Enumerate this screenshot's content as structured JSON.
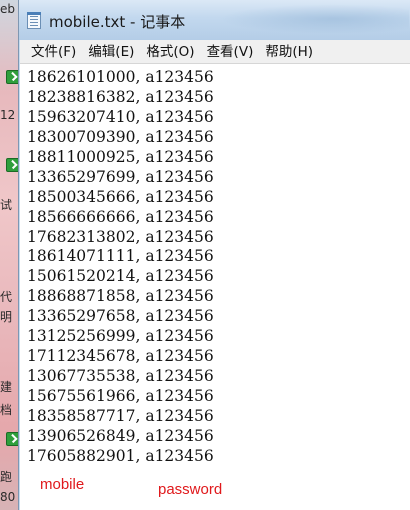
{
  "window": {
    "title": "mobile.txt - 记事本"
  },
  "menu": [
    {
      "label": "文件(F)"
    },
    {
      "label": "编辑(E)"
    },
    {
      "label": "格式(O)"
    },
    {
      "label": "查看(V)"
    },
    {
      "label": "帮助(H)"
    }
  ],
  "editor": {
    "lines": [
      "18626101000, a123456",
      "18238816382, a123456",
      "15963207410, a123456",
      "18300709390, a123456",
      "18811000925, a123456",
      "13365297699, a123456",
      "18500345666, a123456",
      "18566666666, a123456",
      "17682313802, a123456",
      "18614071111, a123456",
      "15061520214, a123456",
      "18868871858, a123456",
      "13365297658, a123456",
      "13125256999, a123456",
      "17112345678, a123456",
      "13067735538, a123456",
      "15675561966, a123456",
      "18358587717, a123456",
      "13906526849, a123456",
      "17605882901, a123456"
    ]
  },
  "annotations": {
    "mobile_label": "mobile",
    "password_label": "password",
    "color": "#e0191c"
  },
  "desktop_fragments": [
    "eb",
    "12",
    "试",
    "代",
    "明",
    "建",
    "档",
    "跑",
    "80"
  ],
  "colors": {
    "titlebar": "#c2d8ee",
    "menubar": "#f0f0f0",
    "editor_bg": "#ffffff"
  },
  "icons": {
    "app": "notepad-icon",
    "desktop_badge": "check-icon"
  }
}
